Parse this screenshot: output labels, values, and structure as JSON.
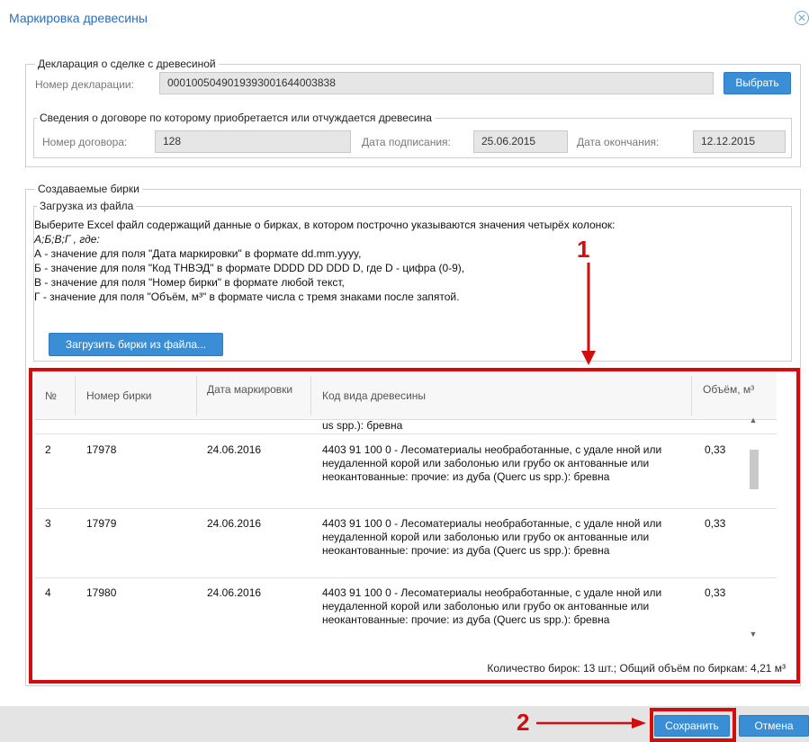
{
  "window": {
    "title": "Маркировка древесины"
  },
  "declaration": {
    "legend": "Декларация о сделке с древесиной",
    "number_label": "Номер декларации:",
    "number_value": "0001005049019393001644003838",
    "select_button": "Выбрать",
    "contract": {
      "legend": "Сведения о договоре по которому приобретается или отчуждается древесина",
      "number_label": "Номер договора:",
      "number_value": "128",
      "signed_label": "Дата подписания:",
      "signed_value": "25.06.2015",
      "end_label": "Дата окончания:",
      "end_value": "12.12.2015"
    }
  },
  "tags": {
    "legend": "Создаваемые бирки",
    "upload": {
      "legend": "Загрузка из файла",
      "lines": [
        "Выберите Excel файл содержащий данные о бирках, в котором построчно указываются значения четырёх колонок:",
        "А;Б;В;Г , где:",
        "А - значение для поля \"Дата маркировки\" в формате dd.mm.yyyy,",
        "Б - значение для поля \"Код ТНВЭД\" в формате DDDD DD DDD D, где D - цифра (0-9),",
        "В - значение для поля \"Номер бирки\" в формате любой текст,",
        "Г - значение для поля \"Объём, м³\" в формате числа с тремя знаками после запятой."
      ],
      "button": "Загрузить бирки из файла..."
    },
    "table": {
      "columns": [
        "№",
        "Номер бирки",
        "Дата маркировки",
        "Код вида древесины",
        "Объём, м³"
      ],
      "partial_row_text": "us spp.): бревна",
      "rows": [
        {
          "n": "2",
          "tag": "17978",
          "date": "24.06.2016",
          "code": "4403 91 100 0 - Лесоматериалы необработанные, с удале нной или неудаленной корой или заболонью или грубо ок антованные или неокантованные: прочие: из дуба (Querc us spp.): бревна",
          "volume": "0,33"
        },
        {
          "n": "3",
          "tag": "17979",
          "date": "24.06.2016",
          "code": "4403 91 100 0 - Лесоматериалы необработанные, с удале нной или неудаленной корой или заболонью или грубо ок антованные или неокантованные: прочие: из дуба (Querc us spp.): бревна",
          "volume": "0,33"
        },
        {
          "n": "4",
          "tag": "17980",
          "date": "24.06.2016",
          "code": "4403 91 100 0 - Лесоматериалы необработанные, с удале нной или неудаленной корой или заболонью или грубо ок антованные или неокантованные: прочие: из дуба (Querc us spp.): бревна",
          "volume": "0,33"
        }
      ],
      "summary": "Количество бирок: 13 шт.; Общий объём по биркам: 4,21 м³"
    }
  },
  "footer": {
    "save": "Сохранить",
    "cancel": "Отмена"
  },
  "annotations": {
    "callout_1": "1",
    "callout_2": "2",
    "color": "#d10d0d"
  }
}
